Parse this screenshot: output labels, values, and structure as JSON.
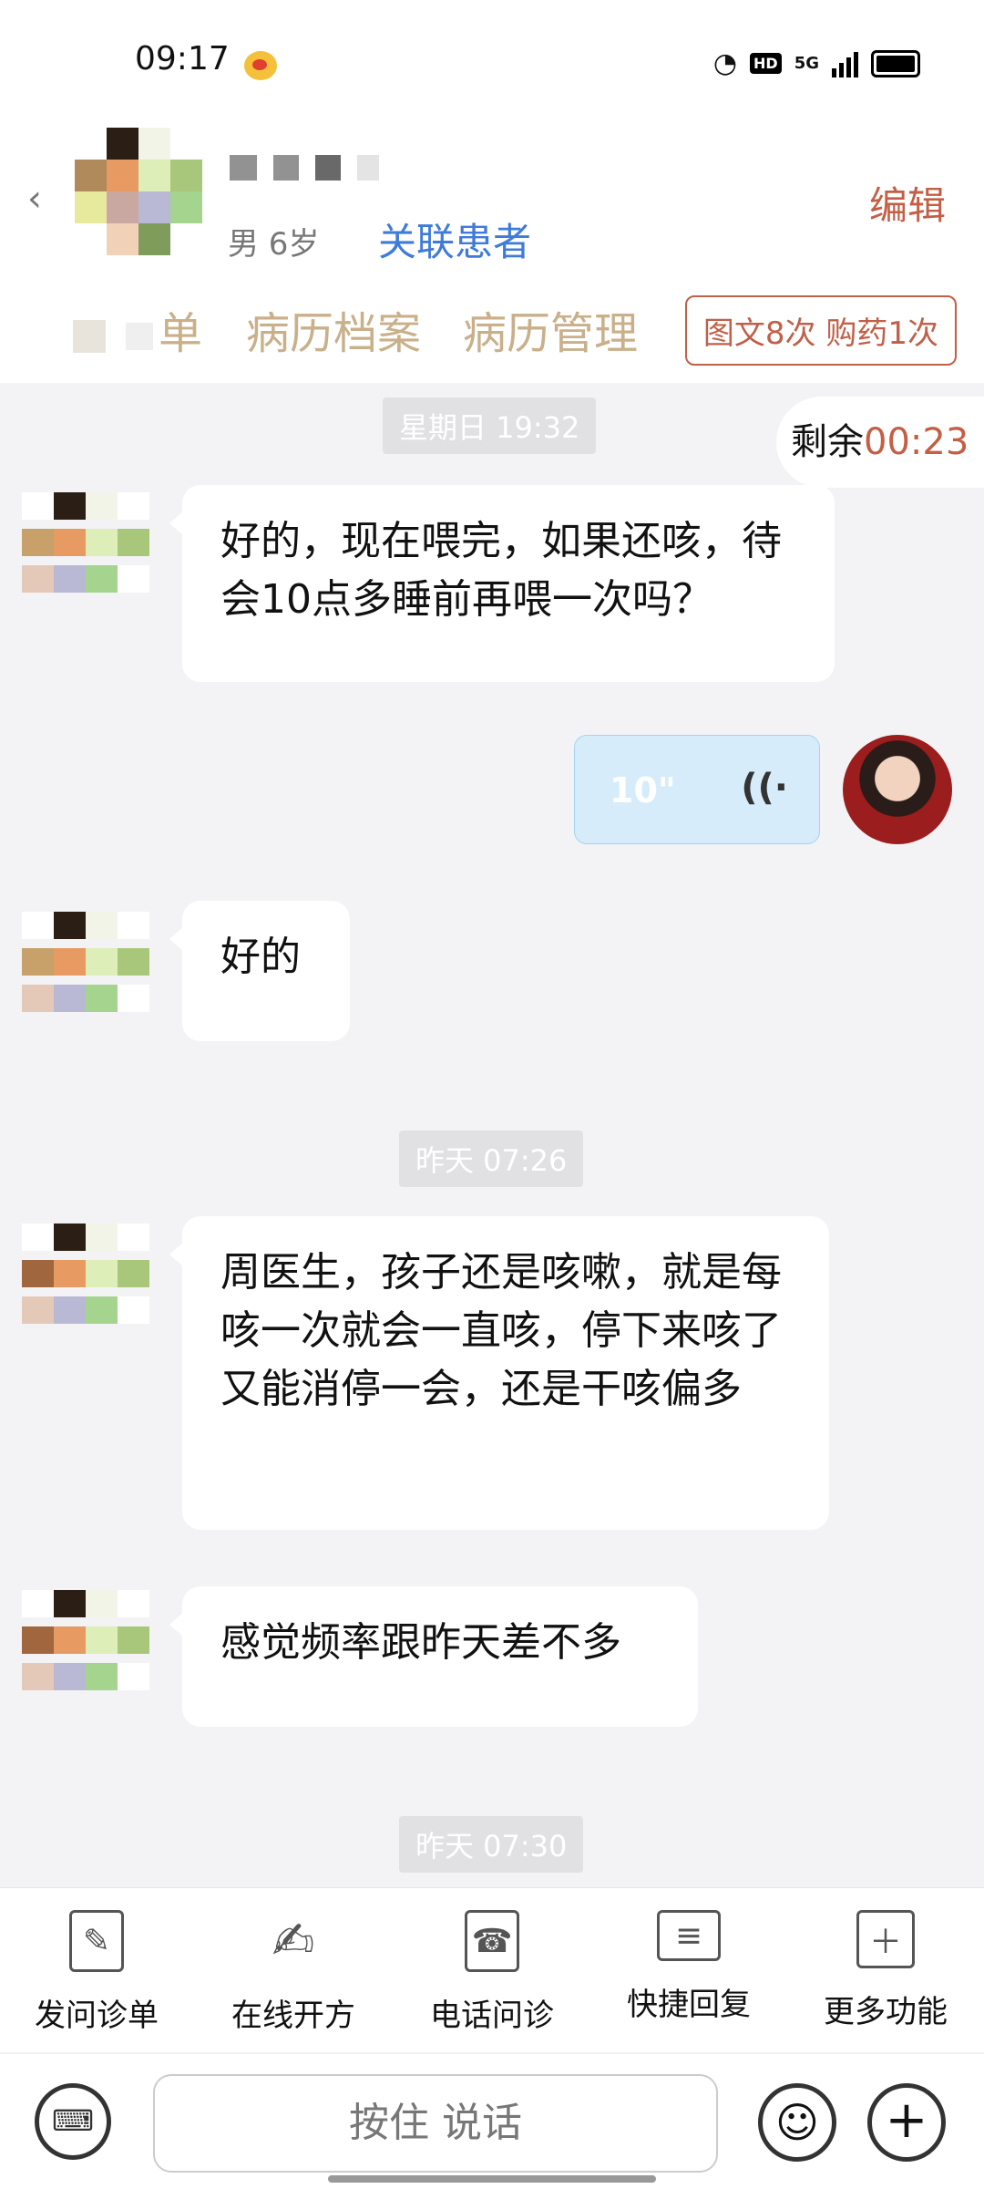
{
  "status_bar": {
    "time": "09:17",
    "hd": "HD",
    "network": "5G"
  },
  "header": {
    "patient_meta": "男 6岁",
    "link_label": "关联患者",
    "edit_label": "编辑"
  },
  "tabs": [
    {
      "label": "单"
    },
    {
      "label": "病历档案"
    },
    {
      "label": "病历管理"
    }
  ],
  "quota_badge": "图文8次 购药1次",
  "timer": {
    "prefix": "剩余",
    "value": "00:23"
  },
  "messages": {
    "time1": "星期日 19:32",
    "m1": "好的，现在喂完，如果还咳，待会10点多睡前再喂一次吗？",
    "voice_duration": "10\"",
    "m2": "好的",
    "time2": "昨天 07:26",
    "m3": "周医生，孩子还是咳嗽，就是每咳一次就会一直咳，停下来咳了又能消停一会，还是干咳偏多",
    "m4": "感觉频率跟昨天差不多",
    "time3": "昨天 07:30"
  },
  "toolbar": [
    {
      "label": "发问诊单",
      "icon": "form-icon"
    },
    {
      "label": "在线开方",
      "icon": "prescription-icon"
    },
    {
      "label": "电话问诊",
      "icon": "phone-icon"
    },
    {
      "label": "快捷回复",
      "icon": "quick-reply-icon"
    },
    {
      "label": "更多功能",
      "icon": "more-icon"
    }
  ],
  "input": {
    "talk_label": "按住 说话"
  },
  "colors": {
    "accent": "#c45e44",
    "link": "#3f7bd8",
    "tab": "#c9b08a"
  }
}
